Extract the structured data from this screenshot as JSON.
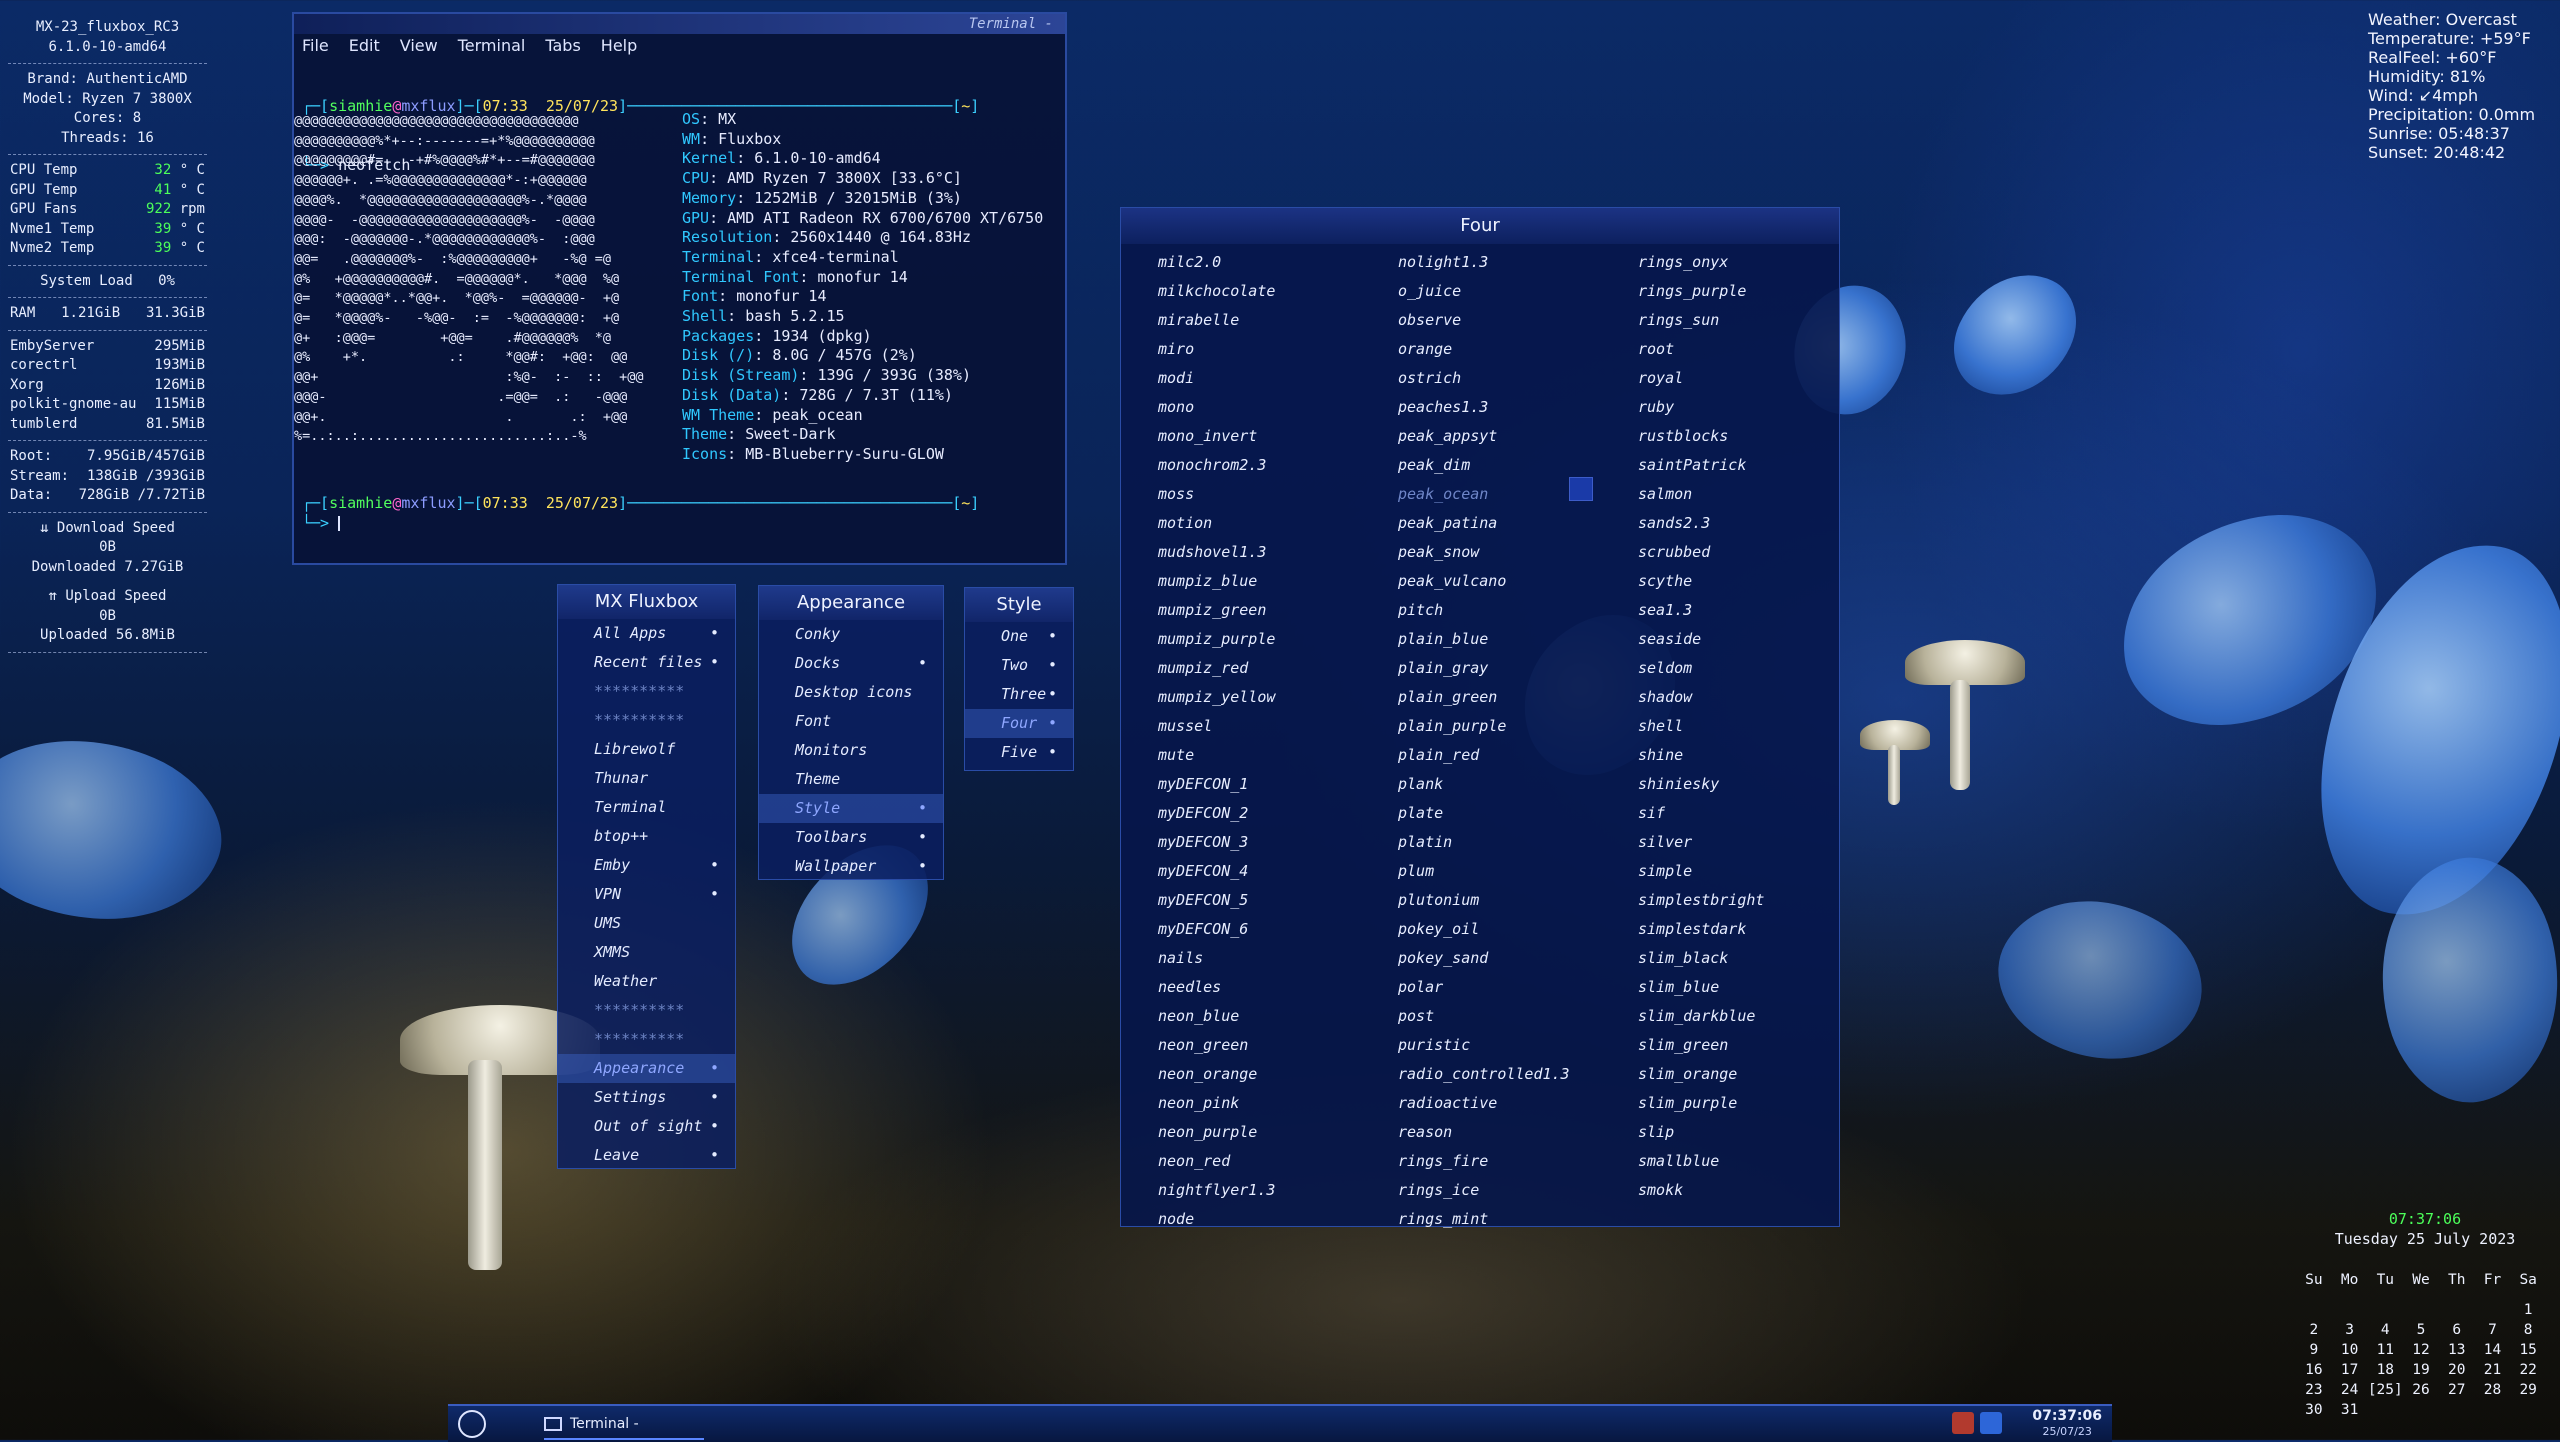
{
  "conky_left": {
    "host": "MX-23_fluxbox_RC3",
    "kernel": "6.1.0-10-amd64",
    "brand_label": "Brand:",
    "brand": "AuthenticAMD",
    "model_label": "Model:",
    "model": "Ryzen 7 3800X",
    "cores_label": "Cores:",
    "cores": "8",
    "threads_label": "Threads:",
    "threads": "16",
    "temps": [
      {
        "label": "CPU Temp",
        "value": "32",
        "unit": "° C"
      },
      {
        "label": "GPU Temp",
        "value": "41",
        "unit": "° C"
      },
      {
        "label": "GPU Fans",
        "value": "922",
        "unit": "rpm"
      },
      {
        "label": "Nvme1 Temp",
        "value": "39",
        "unit": "° C"
      },
      {
        "label": "Nvme2 Temp",
        "value": "39",
        "unit": "° C"
      }
    ],
    "sysload_label": "System Load",
    "sysload": "0%",
    "ram_label": "RAM",
    "ram_used": "1.21GiB",
    "ram_total": "31.3GiB",
    "processes": [
      {
        "name": "EmbyServer",
        "mem": "295MiB"
      },
      {
        "name": "corectrl",
        "mem": "193MiB"
      },
      {
        "name": "Xorg",
        "mem": "126MiB"
      },
      {
        "name": "polkit-gnome-au",
        "mem": "115MiB"
      },
      {
        "name": "tumblerd",
        "mem": "81.5MiB"
      }
    ],
    "disks": [
      {
        "label": "Root:",
        "value": "7.95GiB/457GiB"
      },
      {
        "label": "Stream:",
        "value": "138GiB /393GiB"
      },
      {
        "label": "Data:",
        "value": "728GiB /7.72TiB"
      }
    ],
    "download_label": "⇊ Download Speed",
    "download_speed": "0B",
    "downloaded_label": "Downloaded",
    "downloaded": "7.27GiB",
    "upload_label": "⇈ Upload Speed",
    "upload_speed": "0B",
    "uploaded_label": "Uploaded",
    "uploaded": "56.8MiB"
  },
  "terminal": {
    "window_title": "Terminal -",
    "menu": [
      "File",
      "Edit",
      "View",
      "Terminal",
      "Tabs",
      "Help"
    ],
    "prompt_user": "siamhie",
    "prompt_at": "@",
    "prompt_host": "mxflux",
    "prompt_time": "07:33",
    "prompt_date": "25/07/23",
    "prompt_dir": "~",
    "command": "neofetch",
    "logo_lines": [
      "@@@@@@@@@@@@@@@@@@@@@@@@@@@@@@@@@@@",
      "@@@@@@@@@@%*+--:-------=+*%@@@@@@@@@@",
      "@@@@@@@@@#=. .-+#%@@@@%#*+--=#@@@@@@@",
      "@@@@@@+. .=%@@@@@@@@@@@@@@*-:+@@@@@@",
      "@@@@%.  *@@@@@@@@@@@@@@@@@@@%-.*@@@@",
      "@@@@-  -@@@@@@@@@@@@@@@@@@@@%-  -@@@@",
      "@@@:  -@@@@@@@-.*@@@@@@@@@@@@%-  :@@@",
      "@@=   .@@@@@@@%-  :%@@@@@@@@@+   -%@ =@",
      "@%   +@@@@@@@@@@#.  =@@@@@@*.   *@@@  %@",
      "@=   *@@@@@*..*@@+.  *@@%-  =@@@@@@-  +@",
      "@=   *@@@@%-   -%@@-  :=  -%@@@@@@@:  +@",
      "@+   :@@@=        +@@=    .#@@@@@@%  *@",
      "@%    +*.          .:     *@@#:  +@@:  @@",
      "@@+                       :%@-  :-  ::  +@@",
      "@@@-                     .=@@=  .:   -@@@",
      "@@+.                      .       .:  +@@",
      "%=..:..:.......................:..-%"
    ],
    "info": [
      {
        "k": "OS",
        "v": "MX"
      },
      {
        "k": "WM",
        "v": "Fluxbox"
      },
      {
        "k": "Kernel",
        "v": "6.1.0-10-amd64"
      },
      {
        "k": "CPU",
        "v": "AMD Ryzen 7 3800X [33.6°C]"
      },
      {
        "k": "Memory",
        "v": "1252MiB / 32015MiB (3%)"
      },
      {
        "k": "GPU",
        "v": "AMD ATI Radeon RX 6700/6700 XT/6750"
      },
      {
        "k": "Resolution",
        "v": "2560x1440 @ 164.83Hz"
      },
      {
        "k": "Terminal",
        "v": "xfce4-terminal"
      },
      {
        "k": "Terminal Font",
        "v": "monofur 14"
      },
      {
        "k": "Font",
        "v": "monofur 14"
      },
      {
        "k": "Shell",
        "v": "bash 5.2.15"
      },
      {
        "k": "Packages",
        "v": "1934 (dpkg)"
      },
      {
        "k": "Disk (/)",
        "v": "8.0G / 457G (2%)"
      },
      {
        "k": "Disk (Stream)",
        "v": "139G / 393G (38%)"
      },
      {
        "k": "Disk (Data)",
        "v": "728G / 7.3T (11%)"
      },
      {
        "k": "WM Theme",
        "v": "peak_ocean"
      },
      {
        "k": "Theme",
        "v": "Sweet-Dark"
      },
      {
        "k": "Icons",
        "v": "MB-Blueberry-Suru-GLOW"
      }
    ]
  },
  "menu_main": {
    "title": "MX Fluxbox",
    "items": [
      {
        "label": "All Apps",
        "sub": true
      },
      {
        "label": "Recent files",
        "sub": true
      },
      {
        "label": "**********",
        "sub": false,
        "dim": true
      },
      {
        "label": "**********",
        "sub": false,
        "dim": true
      },
      {
        "label": "Librewolf",
        "sub": false
      },
      {
        "label": "Thunar",
        "sub": false
      },
      {
        "label": "Terminal",
        "sub": false
      },
      {
        "label": "btop++",
        "sub": false
      },
      {
        "label": "Emby",
        "sub": true
      },
      {
        "label": "VPN",
        "sub": true
      },
      {
        "label": "UMS",
        "sub": false
      },
      {
        "label": "XMMS",
        "sub": false
      },
      {
        "label": "Weather",
        "sub": false
      },
      {
        "label": "**********",
        "sub": false,
        "dim": true
      },
      {
        "label": "**********",
        "sub": false,
        "dim": true
      },
      {
        "label": "Appearance",
        "sub": true,
        "hl": true
      },
      {
        "label": "Settings",
        "sub": true
      },
      {
        "label": "Out of sight",
        "sub": true
      },
      {
        "label": "Leave",
        "sub": true
      }
    ]
  },
  "menu_appearance": {
    "title": "Appearance",
    "items": [
      {
        "label": "Conky",
        "sub": false
      },
      {
        "label": "Docks",
        "sub": true
      },
      {
        "label": "Desktop icons",
        "sub": false
      },
      {
        "label": "Font",
        "sub": false
      },
      {
        "label": "Monitors",
        "sub": false
      },
      {
        "label": "Theme",
        "sub": false
      },
      {
        "label": "Style",
        "sub": true,
        "hl": true
      },
      {
        "label": "Toolbars",
        "sub": true
      },
      {
        "label": "Wallpaper",
        "sub": true
      }
    ]
  },
  "menu_style": {
    "title": "Style",
    "items": [
      {
        "label": "One",
        "sub": true
      },
      {
        "label": "Two",
        "sub": true
      },
      {
        "label": "Three",
        "sub": true
      },
      {
        "label": "Four",
        "sub": true,
        "hl": true
      },
      {
        "label": "Five",
        "sub": true
      }
    ]
  },
  "menu_four": {
    "title": "Four",
    "col1": [
      "milc2.0",
      "milkchocolate",
      "mirabelle",
      "miro",
      "modi",
      "mono",
      "mono_invert",
      "monochrom2.3",
      "moss",
      "motion",
      "mudshovel1.3",
      "mumpiz_blue",
      "mumpiz_green",
      "mumpiz_purple",
      "mumpiz_red",
      "mumpiz_yellow",
      "mussel",
      "mute",
      "myDEFCON_1",
      "myDEFCON_2",
      "myDEFCON_3",
      "myDEFCON_4",
      "myDEFCON_5",
      "myDEFCON_6",
      "nails",
      "needles",
      "neon_blue",
      "neon_green",
      "neon_orange",
      "neon_pink",
      "neon_purple",
      "neon_red",
      "nightflyer1.3",
      "node"
    ],
    "col2": [
      "nolight1.3",
      "o_juice",
      "observe",
      "orange",
      "ostrich",
      "peaches1.3",
      "peak_appsyt",
      "peak_dim",
      "peak_ocean",
      "peak_patina",
      "peak_snow",
      "peak_vulcano",
      "pitch",
      "plain_blue",
      "plain_gray",
      "plain_green",
      "plain_purple",
      "plain_red",
      "plank",
      "plate",
      "platin",
      "plum",
      "plutonium",
      "pokey_oil",
      "pokey_sand",
      "polar",
      "post",
      "puristic",
      "radio_controlled1.3",
      "radioactive",
      "reason",
      "rings_fire",
      "rings_ice",
      "rings_mint"
    ],
    "col3": [
      "rings_onyx",
      "rings_purple",
      "rings_sun",
      "root",
      "royal",
      "ruby",
      "rustblocks",
      "saintPatrick",
      "salmon",
      "sands2.3",
      "scrubbed",
      "scythe",
      "sea1.3",
      "seaside",
      "seldom",
      "shadow",
      "shell",
      "shine",
      "shiniesky",
      "sif",
      "silver",
      "simple",
      "simplestbright",
      "simplestdark",
      "slim_black",
      "slim_blue",
      "slim_darkblue",
      "slim_green",
      "slim_orange",
      "slim_purple",
      "slip",
      "smallblue",
      "smokk"
    ],
    "selected": "peak_ocean"
  },
  "weather": {
    "lines": [
      "Weather: Overcast",
      "Temperature: +59°F",
      "RealFeel: +60°F",
      "Humidity: 81%",
      "Wind: ↙4mph",
      "Precipitation: 0.0mm",
      "Sunrise: 05:48:37",
      "Sunset: 20:48:42"
    ]
  },
  "clock": {
    "time": "07:37:06",
    "date": "Tuesday 25 July 2023"
  },
  "calendar": {
    "days": [
      "Su",
      "Mo",
      "Tu",
      "We",
      "Th",
      "Fr",
      "Sa"
    ],
    "weeks": [
      [
        "",
        "",
        "",
        "",
        "",
        "",
        "1"
      ],
      [
        "2",
        "3",
        "4",
        "5",
        "6",
        "7",
        "8"
      ],
      [
        "9",
        "10",
        "11",
        "12",
        "13",
        "14",
        "15"
      ],
      [
        "16",
        "17",
        "18",
        "19",
        "20",
        "21",
        "22"
      ],
      [
        "23",
        "24",
        "[25]",
        "26",
        "27",
        "28",
        "29"
      ],
      [
        "30",
        "31",
        "",
        "",
        "",
        "",
        ""
      ]
    ]
  },
  "taskbar": {
    "task_label": "Terminal -",
    "time": "07:37:06",
    "date": "25/07/23"
  }
}
